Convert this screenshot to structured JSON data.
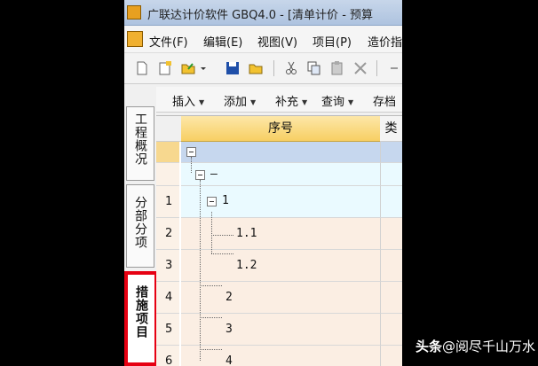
{
  "window": {
    "title": "广联达计价软件 GBQ4.0 - [清单计价 - 预算"
  },
  "menu": {
    "items": [
      "文件(F)",
      "编辑(E)",
      "视图(V)",
      "项目(P)",
      "造价指"
    ]
  },
  "subtoolbar": {
    "items": [
      "插入",
      "添加",
      "补充",
      "查询",
      "存档"
    ]
  },
  "sidebar": {
    "tabs": [
      "工程概况",
      "分部分项",
      "措施项目"
    ],
    "active_index": 2
  },
  "grid": {
    "columns": {
      "seq": "序号",
      "type": "类"
    },
    "rows": [
      {
        "num": "",
        "label": ""
      },
      {
        "num": "",
        "label": "—"
      },
      {
        "num": "1",
        "label": "1"
      },
      {
        "num": "2",
        "label": "1.1"
      },
      {
        "num": "3",
        "label": "1.2"
      },
      {
        "num": "4",
        "label": "2"
      },
      {
        "num": "5",
        "label": "3"
      },
      {
        "num": "6",
        "label": "4"
      }
    ]
  },
  "watermark": {
    "prefix": "头条",
    "handle": "@阅尽千山万水"
  },
  "colors": {
    "active_tab_border": "#e60012",
    "header": "#f7cf63"
  }
}
